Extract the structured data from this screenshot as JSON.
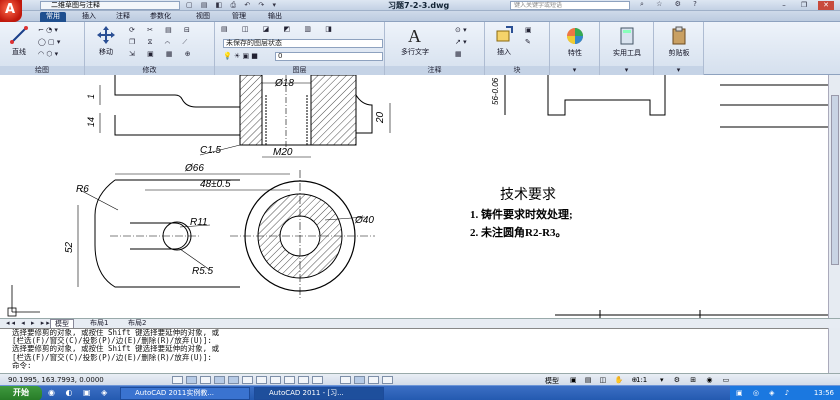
{
  "titlebar": {
    "logo_letter": "A",
    "workspace": "二维草图与注释",
    "document": "习题7-2-3.dwg",
    "search_placeholder": "键入关键字或短语"
  },
  "ribbon_tabs": [
    "常用",
    "插入",
    "注释",
    "参数化",
    "视图",
    "管理",
    "输出"
  ],
  "ribbon": {
    "draw_panel": {
      "label": "绘图",
      "line_label": "直线"
    },
    "modify_panel": {
      "label": "修改",
      "move_label": "移动"
    },
    "layer_panel": {
      "label": "图层",
      "layer_state": "未保存的图层状态",
      "current_layer": "0"
    },
    "annotate_panel": {
      "label": "注释",
      "mtext_label": "多行文字"
    },
    "block_panel": {
      "label": "块",
      "insert_label": "插入"
    },
    "properties_label": "特性",
    "utilities_label": "实用工具",
    "clipboard_label": "剪贴板"
  },
  "drawing": {
    "dims": {
      "d18": "Ø18",
      "c15": "C1.5",
      "m20": "M20",
      "d20": "20",
      "d14": "14",
      "d1": "1",
      "d66": "Ø66",
      "d48": "48±0.5",
      "r6": "R6",
      "r11": "R11",
      "r55": "R5.5",
      "d40": "Ø40",
      "d52": "52",
      "tol": "56-0.06"
    },
    "notes": {
      "title": "技术要求",
      "line1": "1. 铸件要求时效处理;",
      "line2": "2. 未注圆角R2-R3。"
    }
  },
  "layout_tabs": [
    "模型",
    "布局1",
    "布局2"
  ],
  "command": {
    "lines": [
      "选择要修剪的对象, 或按住 Shift 键选择要延伸的对象, 或",
      "[栏选(F)/窗交(C)/投影(P)/边(E)/删除(R)/放弃(U)]:",
      "选择要修剪的对象, 或按住 Shift 键选择要延伸的对象, 或",
      "[栏选(F)/窗交(C)/投影(P)/边(E)/删除(R)/放弃(U)]:",
      "命令:"
    ]
  },
  "status": {
    "coords": "90.1995, 163.7993, 0.0000",
    "model_label": "模型",
    "scale": "1:1"
  },
  "taskbar": {
    "start": "开始",
    "tasks": [
      "AutoCAD 2011实例教...",
      "AutoCAD 2011 - [习..."
    ],
    "clock": "13:56"
  },
  "colors": {
    "ribbon_active_tab": "#1f4f8f",
    "taskbar": "#245ab0",
    "start": "#267a26"
  }
}
